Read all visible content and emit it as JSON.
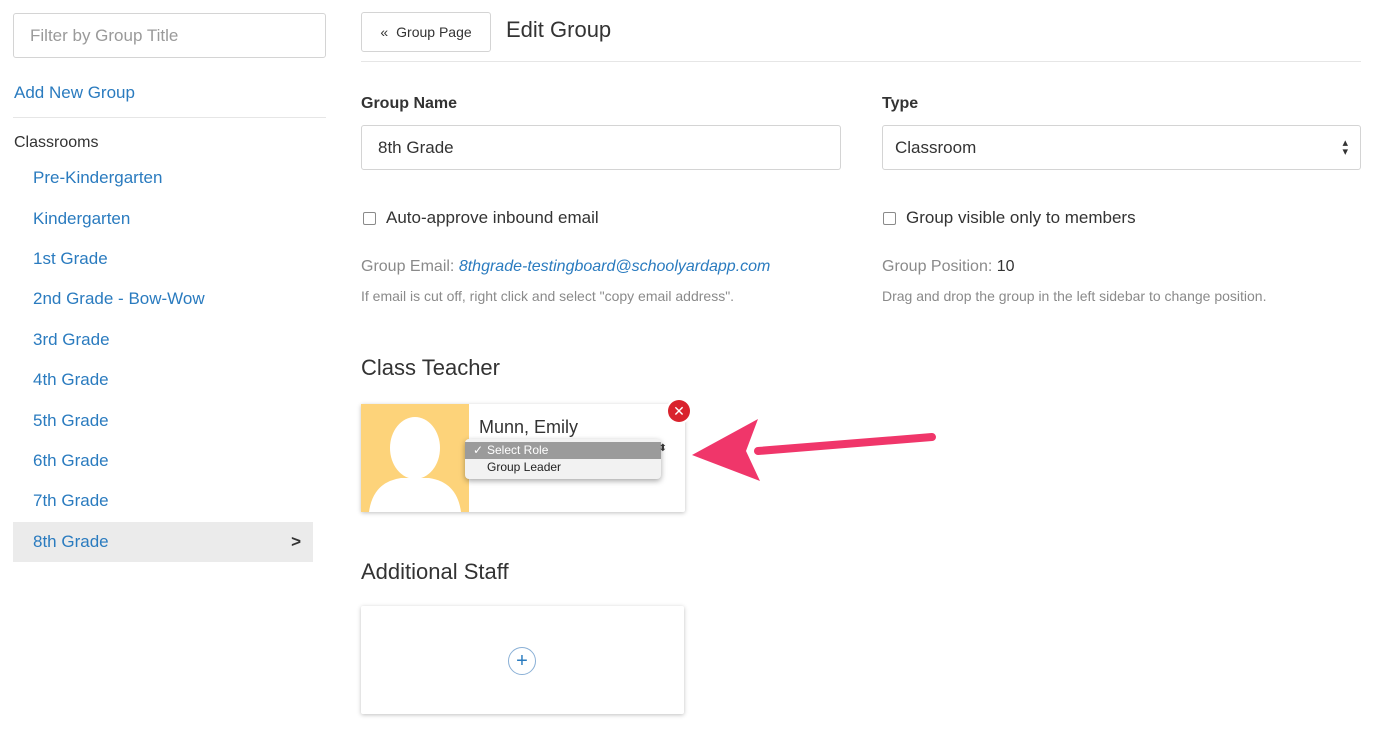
{
  "sidebar": {
    "filter_placeholder": "Filter by Group Title",
    "add_new_group": "Add New Group",
    "heading": "Classrooms",
    "items": [
      {
        "label": "Pre-Kindergarten"
      },
      {
        "label": "Kindergarten"
      },
      {
        "label": "1st Grade"
      },
      {
        "label": "2nd Grade - Bow-Wow"
      },
      {
        "label": "3rd Grade"
      },
      {
        "label": "4th Grade"
      },
      {
        "label": "5th Grade"
      },
      {
        "label": "6th Grade"
      },
      {
        "label": "7th Grade"
      },
      {
        "label": "8th Grade",
        "active": true
      }
    ],
    "active_chevron": ">"
  },
  "header": {
    "back_label": "Group Page",
    "back_icon": "«",
    "title": "Edit Group"
  },
  "form": {
    "group_name_label": "Group Name",
    "group_name_value": "8th Grade",
    "type_label": "Type",
    "type_value": "Classroom",
    "auto_approve_label": "Auto-approve inbound email",
    "visible_members_label": "Group visible only to members",
    "group_email_label": "Group Email:",
    "group_email_value": "8thgrade-testingboard@schoolyardapp.com",
    "email_hint": "If email is cut off, right click and select \"copy email address\".",
    "position_label": "Group Position:",
    "position_value": "10",
    "position_hint": "Drag and drop the group in the left sidebar to change position."
  },
  "class_teacher": {
    "title": "Class Teacher",
    "name": "Munn, Emily",
    "role_options": [
      "Select Role",
      "Group Leader"
    ],
    "selected_role": "Select Role",
    "check_mark": "✓"
  },
  "additional_staff": {
    "title": "Additional Staff",
    "add_symbol": "+"
  },
  "colors": {
    "link": "#2a7bbf",
    "avatar_bg": "#fdd37a",
    "remove": "#d9232d",
    "arrow": "#f0366a"
  }
}
